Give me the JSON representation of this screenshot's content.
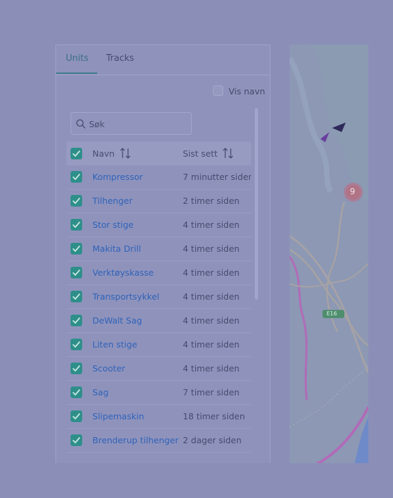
{
  "tabs": {
    "units": "Units",
    "tracks": "Tracks"
  },
  "vis_navn": "Vis navn",
  "search": {
    "placeholder": "Søk"
  },
  "columns": {
    "name": "Navn",
    "last_seen": "Sist sett"
  },
  "rows": [
    {
      "name": "Kompressor",
      "time": "7 minutter siden"
    },
    {
      "name": "Tilhenger",
      "time": "2 timer siden"
    },
    {
      "name": "Stor stige",
      "time": "4 timer siden"
    },
    {
      "name": "Makita Drill",
      "time": "4 timer siden"
    },
    {
      "name": "Verktøyskasse",
      "time": "4 timer siden"
    },
    {
      "name": "Transportsykkel",
      "time": "4 timer siden"
    },
    {
      "name": "DeWalt Sag",
      "time": "4 timer siden"
    },
    {
      "name": "Liten stige",
      "time": "4 timer siden"
    },
    {
      "name": "Scooter",
      "time": "4 timer siden"
    },
    {
      "name": "Sag",
      "time": "7 timer siden"
    },
    {
      "name": "Slipemaskin",
      "time": "18 timer siden"
    },
    {
      "name": "Brenderup tilhenger",
      "time": "2 dager siden"
    }
  ],
  "map": {
    "cluster_count": "9",
    "road_label": "E16"
  },
  "colors": {
    "accent": "#2e8f8a",
    "link": "#2f62b8",
    "overlay": "#8b8fb8"
  }
}
